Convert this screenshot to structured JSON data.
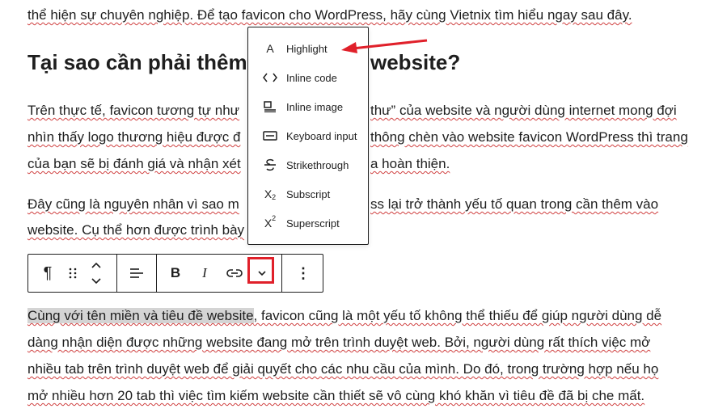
{
  "article": {
    "line1": "thể hiện sự chuyên nghiệp. Để tạo favicon cho WordPress, hãy cùng Vietnix tìm hiểu ngay sau đây.",
    "heading_left": "Tại sao cần phải thêm",
    "heading_right": "website?",
    "p2_l1a": "Trên thực tế, favicon tương tự như",
    "p2_l1b": "thư” của website và người dùng internet mong đợi",
    "p2_l2a": "nhìn thấy logo thương hiệu được đ",
    "p2_l2b": "thông chèn vào website favicon WordPress thì trang",
    "p2_l3a": "của bạn sẽ bị đánh giá và nhận xét",
    "p2_l3b": "a hoàn thiện.",
    "p3_l1a": "Đây cũng là nguyên nhân vì sao m",
    "p3_l1b": "ss lại trở thành yếu tố quan trong cần thêm vào",
    "p3_l2a": "website. Cụ thể hơn được trình bày",
    "p4_highlight": "Cùng với tên miền và tiêu đề website",
    "p4_l1": ", favicon cũng là một yếu tố không thể thiếu để giúp người dùng dễ",
    "p4_l2": "dàng nhận diện được những website đang mở trên trình duyệt web. Bởi, người dùng rất thích việc mở",
    "p4_l3": "nhiều tab trên trình duyệt web để giải quyết cho các nhu cầu của mình. Do đó, trong trường hợp nếu họ",
    "p4_l4": "mở nhiều hơn 20 tab thì việc tìm kiếm website cần thiết sẽ vô cùng khó khăn vì tiêu đề đã bị che mất."
  },
  "format_menu": {
    "items": [
      {
        "label": "Highlight",
        "icon": "highlight-icon"
      },
      {
        "label": "Inline code",
        "icon": "code-icon"
      },
      {
        "label": "Inline image",
        "icon": "image-icon"
      },
      {
        "label": "Keyboard input",
        "icon": "keyboard-icon"
      },
      {
        "label": "Strikethrough",
        "icon": "strikethrough-icon"
      },
      {
        "label": "Subscript",
        "icon": "subscript-icon"
      },
      {
        "label": "Superscript",
        "icon": "superscript-icon"
      }
    ]
  },
  "toolbar": {
    "paragraph_glyph": "¶",
    "bold_glyph": "B",
    "italic_glyph": "I",
    "more_glyph": "⋮"
  },
  "colors": {
    "annotation_red": "#e0202a",
    "highlight_gray": "#d4d4d4",
    "text": "#1e1e1e"
  }
}
